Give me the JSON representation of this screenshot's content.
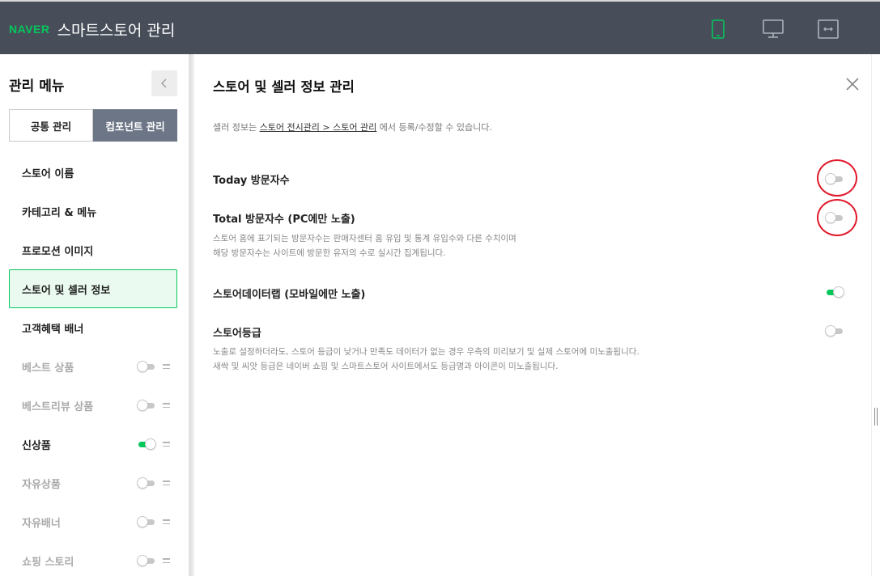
{
  "header": {
    "logo": "NAVER",
    "title": "스마트스토어 관리",
    "colors": {
      "bar": "#474e5a",
      "brand": "#03c75a"
    },
    "view_buttons": [
      {
        "name": "mobile-view-icon",
        "active": true
      },
      {
        "name": "desktop-view-icon",
        "active": false
      },
      {
        "name": "full-width-icon",
        "active": false
      }
    ]
  },
  "sidebar": {
    "title": "관리 메뉴",
    "collapse_icon": "chevron-left-icon",
    "tabs": [
      {
        "label": "공통 관리",
        "selected": false
      },
      {
        "label": "컴포넌트 관리",
        "selected": true
      }
    ],
    "items": [
      {
        "label": "스토어 이름"
      },
      {
        "label": "카테고리 & 메뉴"
      },
      {
        "label": "프로모션 이미지"
      },
      {
        "label": "스토어 및 셀러 정보",
        "active": true
      },
      {
        "label": "고객혜택 배너"
      },
      {
        "label": "베스트 상품",
        "toggle": false
      },
      {
        "label": "베스트리뷰 상품",
        "toggle": false
      },
      {
        "label": "신상품",
        "toggle": true
      },
      {
        "label": "자유상품",
        "toggle": false
      },
      {
        "label": "자유배너",
        "toggle": false
      },
      {
        "label": "쇼핑 스토리",
        "toggle": false
      }
    ]
  },
  "panel": {
    "title": "스토어 및 셀러 정보 관리",
    "close_icon": "close-icon",
    "notice": {
      "prefix": "셀러 정보는 ",
      "link": "스토어 전시관리 > 스토어 관리",
      "suffix": " 에서 등록/수정할 수 있습니다."
    },
    "options": [
      {
        "label": "Today 방문자수",
        "on": false,
        "highlighted": true
      },
      {
        "label": "Total 방문자수 (PC에만 노출)",
        "on": false,
        "highlighted": true,
        "desc": [
          "스토어 홈에 표기되는 방문자수는 판매자센터 홈 유입 및 통계 유입수와 다른 수치이며",
          "해당 방문자수는 사이트에 방문한 유저의 수로 실시간 집계됩니다."
        ]
      },
      {
        "label": "스토어데이터랩 (모바일에만 노출)",
        "on": true,
        "highlighted": false
      },
      {
        "label": "스토어등급",
        "on": false,
        "highlighted": false,
        "desc": [
          "노출로 설정하더라도, 스토어 등급이 낮거나 만족도 데이터가 없는 경우 우측의 미리보기 및 실제 스토어에 미노출됩니다.",
          "새싹 및 씨앗 등급은 네이버 쇼핑 및 스마트스토어 사이트에서도 등급명과 아이콘이 미노출됩니다."
        ]
      }
    ]
  },
  "accent_color": "#03c75a",
  "highlight_color": "#e0192b"
}
